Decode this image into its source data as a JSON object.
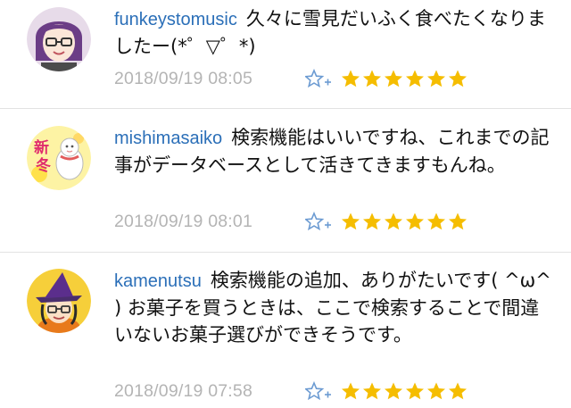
{
  "comments": [
    {
      "username": "funkeystomusic",
      "text": "久々に雪見だいふく食べたくなりましたー(*゜▽゜*)",
      "timestamp": "2018/09/19 08:05",
      "star_count": 6
    },
    {
      "username": "mishimasaiko",
      "text": "検索機能はいいですね、これまでの記事がデータベースとして活きてきますもんね。",
      "timestamp": "2018/09/19 08:01",
      "star_count": 6,
      "avatar_text": "新冬"
    },
    {
      "username": "kamenutsu",
      "text": "検索機能の追加、ありがたいです( ^ω^ ) お菓子を買うときは、ここで検索することで間違いないお菓子選びができそうです。",
      "timestamp": "2018/09/19 07:58",
      "star_count": 6
    }
  ],
  "colors": {
    "username": "#2b6fb8",
    "timestamp": "#b4b4b4",
    "star": "#f5bd00",
    "add_star": "#6c9bd2"
  },
  "icons": {
    "add_star": "add-star-icon",
    "star": "star-icon"
  }
}
